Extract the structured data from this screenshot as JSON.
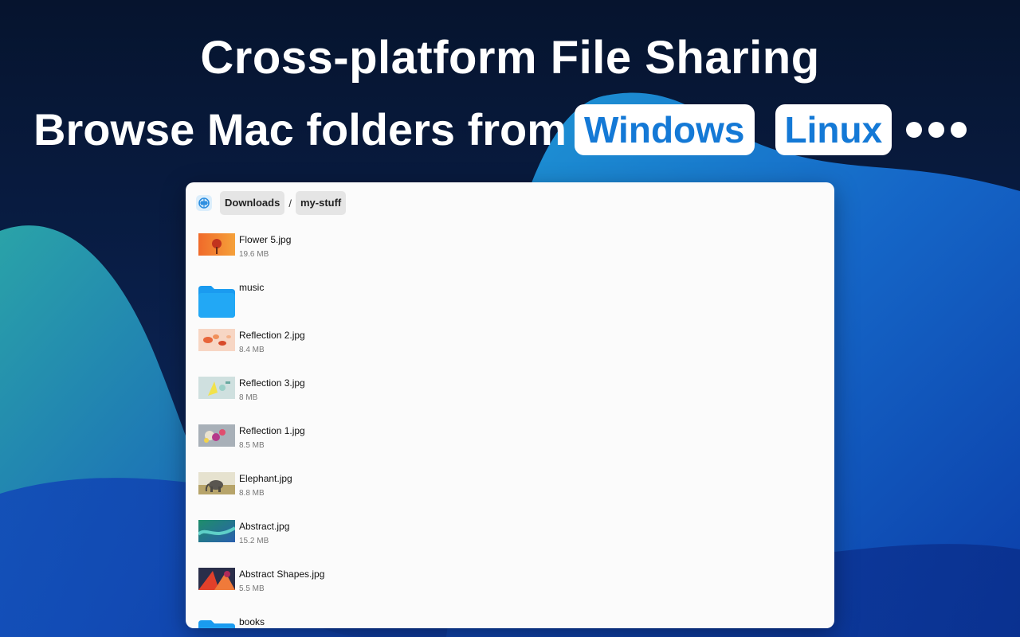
{
  "hero": {
    "line1": "Cross-platform File Sharing",
    "line2_prefix": "Browse Mac folders from",
    "platforms": [
      "Windows",
      "Linux"
    ],
    "more_icon": "ellipsis-icon"
  },
  "colors": {
    "accent": "#1479d6",
    "folder": "#1a9bf0",
    "background_dark": "#0a1a3a",
    "window_bg": "#fbfbfb"
  },
  "toolbar": {
    "app_icon": "file-share-app-icon",
    "breadcrumb": [
      "Downloads",
      "my-stuff"
    ],
    "separator": "/"
  },
  "files": [
    {
      "name": "Flower 5.jpg",
      "size": "19.6 MB",
      "kind": "image"
    },
    {
      "name": "music",
      "size": "",
      "kind": "folder"
    },
    {
      "name": "Reflection 2.jpg",
      "size": "8.4 MB",
      "kind": "image"
    },
    {
      "name": "Reflection 3.jpg",
      "size": "8 MB",
      "kind": "image"
    },
    {
      "name": "Reflection 1.jpg",
      "size": "8.5 MB",
      "kind": "image"
    },
    {
      "name": "Elephant.jpg",
      "size": "8.8 MB",
      "kind": "image"
    },
    {
      "name": "Abstract.jpg",
      "size": "15.2 MB",
      "kind": "image"
    },
    {
      "name": "Abstract Shapes.jpg",
      "size": "5.5 MB",
      "kind": "image"
    },
    {
      "name": "books",
      "size": "",
      "kind": "folder"
    }
  ]
}
